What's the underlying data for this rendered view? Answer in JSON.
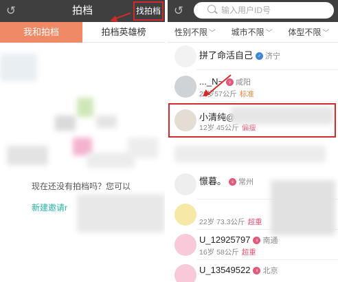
{
  "left": {
    "header": {
      "title": "拍档",
      "find_button": "找拍档"
    },
    "tabs": [
      "我和拍档",
      "拍档英雄榜"
    ],
    "empty_text": "现在还没有拍档吗？您可以",
    "invite_link": "新建邀请r"
  },
  "right": {
    "search": {
      "placeholder": "输入用户ID号"
    },
    "filters": [
      "性别不限",
      "城市不限",
      "体型不限"
    ],
    "users": [
      {
        "name": "拼了命活自己",
        "city": "济宁",
        "badge": "♂",
        "stats": "",
        "tag": "",
        "tag_color": ""
      },
      {
        "name": "..._N~",
        "city": "咸阳",
        "badge": "♀",
        "stats": "25岁57公斤",
        "tag": "标准",
        "tag_color": "orange"
      },
      {
        "name": "小清纯@",
        "city": "",
        "badge": "",
        "stats": "12岁 45公斤",
        "tag": "偏瘦",
        "tag_color": "pink"
      },
      {
        "name": "憬暮。",
        "city": "常州",
        "badge": "♀",
        "stats": "",
        "tag": "",
        "tag_color": ""
      },
      {
        "name": "",
        "city": "",
        "badge": "",
        "stats": "22岁 73.3公斤",
        "tag": "超重",
        "tag_color": "pink"
      },
      {
        "name": "U_12925797",
        "city": "南通",
        "badge": "♀",
        "stats": "16岁 58公斤",
        "tag": "超重",
        "tag_color": "pink"
      },
      {
        "name": "U_13549522",
        "city": "北京",
        "badge": "♀",
        "stats": "",
        "tag": "",
        "tag_color": ""
      }
    ]
  },
  "colors": {
    "header_bg": "#3f3f3f",
    "accent": "#f08a66",
    "link": "#27b3a8",
    "annotation": "#d42a2a"
  }
}
